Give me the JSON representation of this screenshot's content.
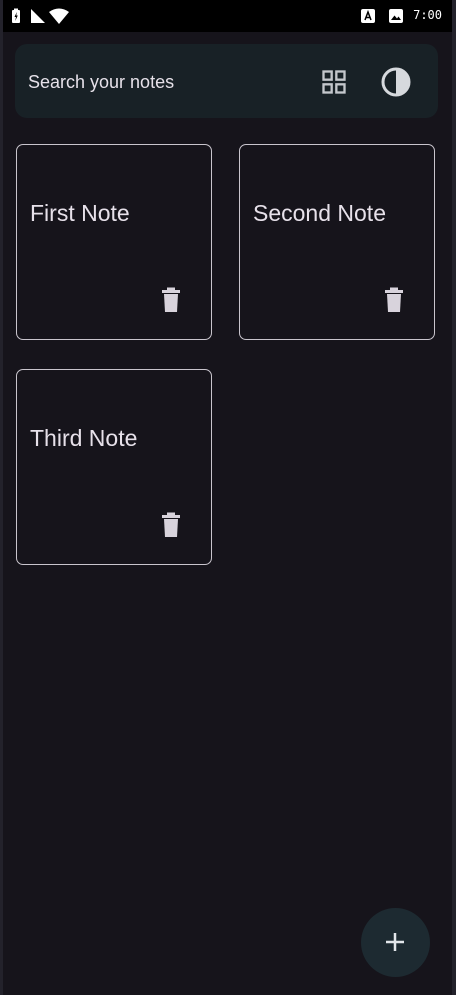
{
  "status_bar": {
    "time": "7:00",
    "left_icons": [
      "battery-charging-icon",
      "signal-icon",
      "wifi-icon"
    ],
    "right_icons": [
      "notification-a-icon",
      "image-icon"
    ]
  },
  "search": {
    "placeholder": "Search your notes",
    "grid_icon": "grid-view-icon",
    "theme_icon": "theme-toggle-icon"
  },
  "notes": [
    {
      "title": "First Note"
    },
    {
      "title": "Second Note"
    },
    {
      "title": "Third Note"
    }
  ],
  "fab": {
    "icon": "plus-icon"
  },
  "colors": {
    "background": "#16141b",
    "search_bar": "#182126",
    "card_border": "#c9c5cd",
    "text": "#e7e1ea",
    "fab": "#1d2a31"
  }
}
